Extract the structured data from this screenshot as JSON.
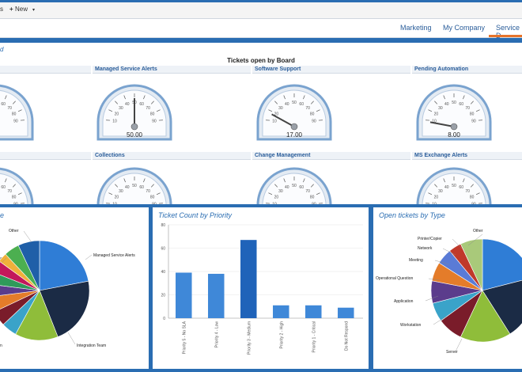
{
  "toolbar": {
    "left_text": "s",
    "new_label": "New",
    "plus": "+",
    "caret": "▾"
  },
  "tabs": [
    {
      "label": "Marketing"
    },
    {
      "label": "My Company"
    },
    {
      "label": "Service D"
    }
  ],
  "dashboard": {
    "section_left_text": "d",
    "board_title": "Tickets open by Board",
    "gauges_row1": [
      {
        "title": "Managed Service Alerts",
        "value": "50.00",
        "level": 0.5
      },
      {
        "title": "Software Support",
        "value": "17.00",
        "level": 0.17
      },
      {
        "title": "Pending Automation",
        "value": "8.00",
        "level": 0.08
      }
    ],
    "gauges_row2": [
      {
        "title": "Collections"
      },
      {
        "title": "Change Management"
      },
      {
        "title": "MS Exchange Alerts"
      }
    ],
    "gauge_ticks": [
      "10",
      "20",
      "30",
      "40",
      "50",
      "60",
      "70",
      "80",
      "90"
    ]
  },
  "pie_board": {
    "title": "e",
    "labels": {
      "other": "Other",
      "msa": "Managed Service Alerts",
      "integration": "Integration Team",
      "left_am": "am",
      "left_n": "n"
    },
    "colors": [
      "#2f7dd6",
      "#1b2b45",
      "#8fbd3a",
      "#3aa3c9",
      "#7a1c2a",
      "#e47c2a",
      "#5b3c8c",
      "#2f9a5a",
      "#c2185b",
      "#f0b03b",
      "#4caf50",
      "#1f5fa8"
    ]
  },
  "bar_chart": {
    "title": "Ticket Count by Priority",
    "chart_data": {
      "type": "bar",
      "title": "Ticket Count by Priority",
      "categories": [
        "Priority 5 - No SLA",
        "Priority 4 - Low",
        "Priority 3 - Medium",
        "Priority 2 - High",
        "Priority 1 - Critical",
        "Do Not Respond"
      ],
      "values": [
        39,
        38,
        67,
        11,
        11,
        9
      ],
      "yticks": [
        "0",
        "20",
        "40",
        "60",
        "80"
      ],
      "ylim": [
        0,
        80
      ],
      "colors": [
        "#3f88d8",
        "#3f88d8",
        "#1f63b9",
        "#3f88d8",
        "#3f88d8",
        "#3f88d8"
      ]
    }
  },
  "pie_type": {
    "title": "Open tickets by Type",
    "labels": {
      "other": "Other",
      "printer": "Printer/Copier",
      "network": "Network",
      "meeting": "Meeting",
      "opq": "Operational Question",
      "application": "Application",
      "workstation": "Workstation",
      "server": "Server"
    }
  }
}
